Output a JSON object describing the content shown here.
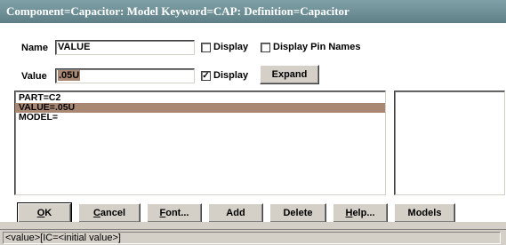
{
  "window": {
    "title": "Component=Capacitor: Model Keyword=CAP: Definition=Capacitor"
  },
  "name_row": {
    "label": "Name",
    "value": "VALUE",
    "display_label": "Display",
    "display_checked": false,
    "display_pin_names_label": "Display Pin Names",
    "display_pin_names_checked": false
  },
  "value_row": {
    "label": "Value",
    "value": ".05U",
    "display_label": "Display",
    "display_checked": true,
    "expand_label": "Expand"
  },
  "attributes_list": {
    "items": [
      {
        "text": "PART=C2",
        "selected": false
      },
      {
        "text": "VALUE=.05U",
        "selected": true
      },
      {
        "text": "MODEL=",
        "selected": false
      }
    ]
  },
  "buttons": {
    "ok": {
      "label": "OK",
      "mnemonic": "O"
    },
    "cancel": {
      "label": "Cancel",
      "mnemonic": "C"
    },
    "font": {
      "label": "Font...",
      "mnemonic": "F"
    },
    "add": {
      "label": "Add"
    },
    "delete": {
      "label": "Delete"
    },
    "help": {
      "label": "Help...",
      "mnemonic": "H"
    },
    "models": {
      "label": "Models"
    }
  },
  "status": {
    "text": "<value>[IC=<initial value>]"
  },
  "colors": {
    "title_bar": "#6e8f95",
    "selection": "#a98873",
    "face": "#d4d0c8"
  }
}
